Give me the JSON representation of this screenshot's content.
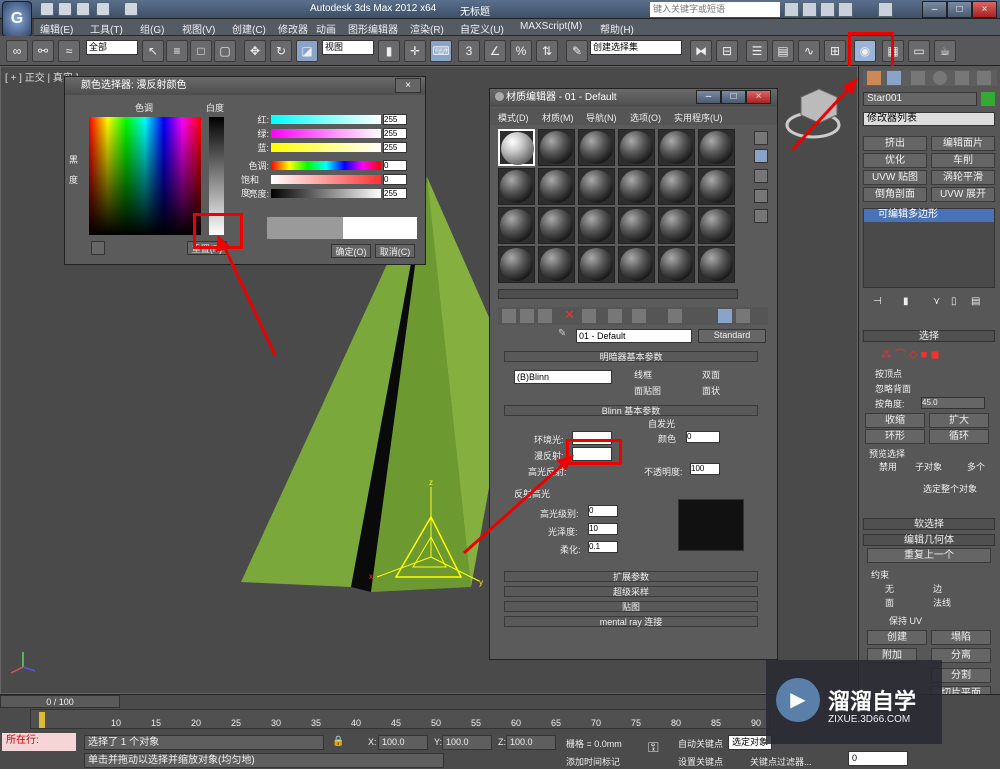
{
  "app": {
    "title": "Autodesk 3ds Max  2012 x64",
    "doc": "无标题",
    "search_placeholder": "键入关键字或短语"
  },
  "menu": [
    "编辑(E)",
    "工具(T)",
    "组(G)",
    "视图(V)",
    "创建(C)",
    "修改器",
    "动画",
    "图形编辑器",
    "渲染(R)",
    "自定义(U)",
    "MAXScript(M)",
    "帮助(H)"
  ],
  "toolbar": {
    "filter": "全部",
    "view": "视图",
    "selset": "创建选择集"
  },
  "viewport": {
    "label": "[ + ] 正交 | 真实 ]"
  },
  "colorpicker": {
    "title": "颜色选择器: 漫反射颜色",
    "hue_label": "色调",
    "white_label": "白度",
    "black_label": "黑",
    "degree_label": "度",
    "rows": [
      {
        "label": "红:",
        "value": "255"
      },
      {
        "label": "绿:",
        "value": "255"
      },
      {
        "label": "蓝:",
        "value": "255"
      },
      {
        "label": "色调:",
        "value": "0"
      },
      {
        "label": "饱和度:",
        "value": "0"
      },
      {
        "label": "亮度:",
        "value": "255"
      }
    ],
    "reset": "重置(R)",
    "ok": "确定(O)",
    "cancel": "取消(C)"
  },
  "mateditor": {
    "title": "材质编辑器 - 01 - Default",
    "menu": [
      "模式(D)",
      "材质(M)",
      "导航(N)",
      "选项(O)",
      "实用程序(U)"
    ],
    "material_name": "01 - Default",
    "material_type": "Standard",
    "shader_section": "明暗器基本参数",
    "shader": "(B)Blinn",
    "shader_opts": [
      "线框",
      "双面",
      "面贴图",
      "面状"
    ],
    "blinn_section": "Blinn 基本参数",
    "self_illum": "自发光",
    "color_label": "颜色",
    "color_value": "0",
    "ambient": "环境光:",
    "diffuse": "漫反射:",
    "specular": "高光反射:",
    "opacity_label": "不透明度:",
    "opacity": "100",
    "spec_section": "反射高光",
    "spec_level_label": "高光级别:",
    "spec_level": "0",
    "gloss_label": "光泽度:",
    "gloss": "10",
    "soften_label": "柔化:",
    "soften": "0.1",
    "rollouts": [
      "扩展参数",
      "超级采样",
      "贴图",
      "mental ray 连接"
    ]
  },
  "command": {
    "object_name": "Star001",
    "modifier_list": "修改器列表",
    "buttons": [
      "挤出",
      "编辑面片",
      "优化",
      "车削",
      "UVW 贴图",
      "涡轮平滑",
      "倒角剖面",
      "UVW 展开"
    ],
    "stack_item": "可编辑多边形",
    "select_section": "选择",
    "by_vertex": "按顶点",
    "ignore_back": "忽略背面",
    "by_angle": "按角度:",
    "angle_value": "45.0",
    "shrink": "收缩",
    "grow": "扩大",
    "ring": "环形",
    "loop": "循环",
    "preview": "预览选择",
    "disable": "禁用",
    "sub_object": "子对象",
    "multi": "多个",
    "whole_object": "选定整个对象",
    "soft_sel": "软选择",
    "edit_geo": "编辑几何体",
    "repeat_last": "重复上一个",
    "constraints": "约束",
    "none": "无",
    "edge": "边",
    "face": "面",
    "normal": "法线",
    "preserve_uv": "保持 UV",
    "create": "创建",
    "collapse": "塌陷",
    "attach": "附加",
    "detach": "分离",
    "slice": "分割",
    "slice_plane": "切片平面",
    "cut": "切割"
  },
  "timeline": {
    "frame": "0 / 100",
    "ticks": [
      "0",
      "10",
      "15",
      "20",
      "25",
      "30",
      "35",
      "40",
      "45",
      "50",
      "55",
      "60",
      "65",
      "70",
      "75",
      "80",
      "85",
      "90"
    ]
  },
  "status": {
    "current": "所在行:",
    "selected": "选择了 1 个对象",
    "hint": "单击并拖动以选择并缩放对象(均匀地)",
    "x": "100.0",
    "y": "100.0",
    "z": "100.0",
    "grid": "栅格 = 0.0mm",
    "auto_key": "自动关键点",
    "set_key": "设置关键点",
    "sel_obj": "选定对象",
    "add_time_tag": "添加时间标记",
    "key_filter": "关键点过滤器...",
    "frame_val": "0"
  },
  "watermark": {
    "brand": "溜溜自学",
    "url": "ZIXUE.3D66.COM"
  }
}
